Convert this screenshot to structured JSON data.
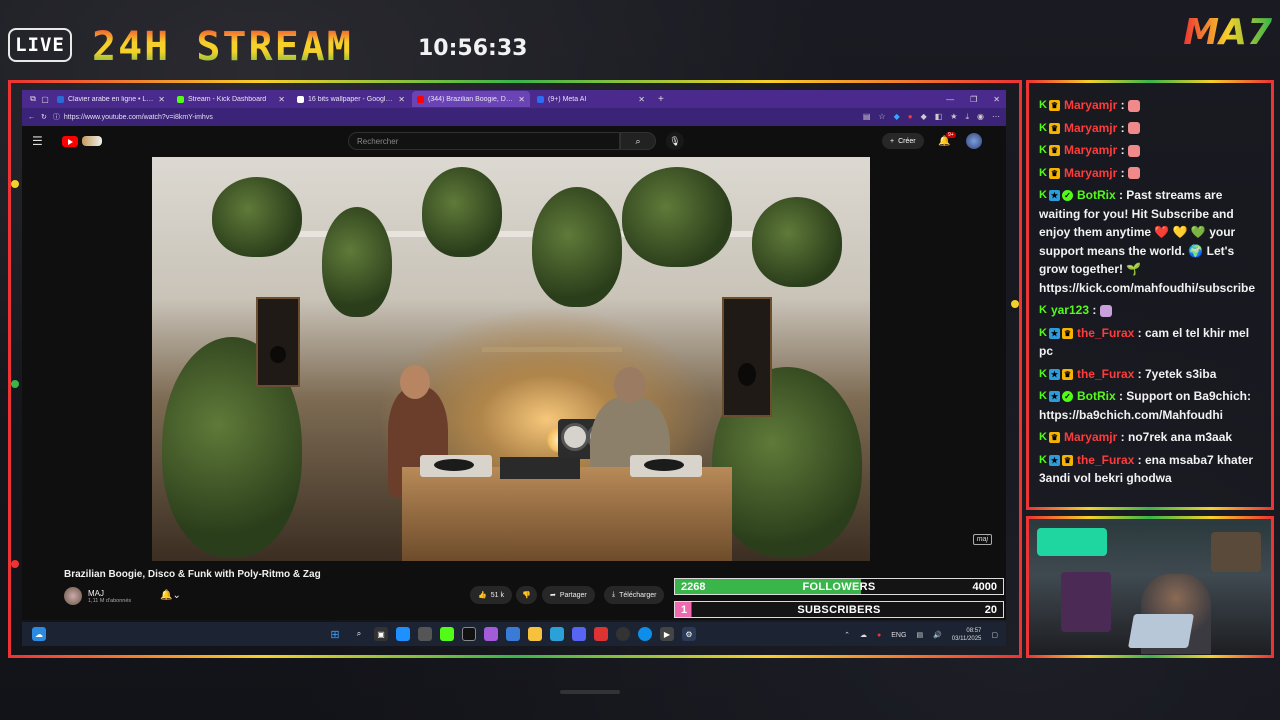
{
  "banner": {
    "live_label": "LIVE",
    "stream_title": "24H STREAM",
    "clock": "10:56:33",
    "logo_text": "MA7"
  },
  "browser": {
    "tabs": [
      {
        "label": "Clavier arabe en ligne • Lexilogos",
        "fav_color": "#2a6bd6",
        "active": false
      },
      {
        "label": "Stream - Kick Dashboard",
        "fav_color": "#53fc18",
        "active": false
      },
      {
        "label": "16 bits wallpaper - Google Search",
        "fav_color": "#ffffff",
        "active": false
      },
      {
        "label": "(344) Brazilian Boogie, Disco",
        "fav_color": "#ff0000",
        "active": true
      },
      {
        "label": "(9+) Meta AI",
        "fav_color": "#2d6cf5",
        "active": false
      }
    ],
    "url": "https://www.youtube.com/watch?v=i8kmY-imhvs"
  },
  "youtube": {
    "search_placeholder": "Rechercher",
    "create_label": "Créer",
    "notif_count": "9+",
    "watermark": "maj",
    "video_title": "Brazilian Boogie, Disco & Funk with Poly-Ritmo & Zag",
    "channel_name": "MAJ",
    "channel_subs": "1,11 M d'abonnés",
    "like_count": "51 k",
    "share_label": "Partager",
    "download_label": "Télécharger"
  },
  "goals": {
    "followers": {
      "current": "2268",
      "label": "FOLLOWERS",
      "target": "4000",
      "progress": 0.567
    },
    "subscribers": {
      "current": "1",
      "label": "SUBSCRIBERS",
      "target": "20",
      "progress": 0.05
    }
  },
  "taskbar": {
    "lang": "ENG",
    "time": "08:57",
    "date": "03/11/2025"
  },
  "chat": [
    {
      "user": "Maryamjr",
      "color": "#ff3b3b",
      "badges": [
        "k",
        "mod"
      ],
      "text": "",
      "emote": "#f08a8a"
    },
    {
      "user": "Maryamjr",
      "color": "#ff3b3b",
      "badges": [
        "k",
        "mod"
      ],
      "text": "",
      "emote": "#f08a8a"
    },
    {
      "user": "Maryamjr",
      "color": "#ff3b3b",
      "badges": [
        "k",
        "mod"
      ],
      "text": "",
      "emote": "#f08a8a"
    },
    {
      "user": "Maryamjr",
      "color": "#ff3b3b",
      "badges": [
        "k",
        "mod"
      ],
      "text": "",
      "emote": "#f08a8a"
    },
    {
      "user": "BotRix",
      "color": "#53fc18",
      "badges": [
        "k",
        "sub",
        "verif"
      ],
      "text": "Past streams are waiting for you! Hit Subscribe and enjoy them anytime ❤️ 💛 💚 your support means the world. 🌍 Let's grow together! 🌱 https://kick.com/mahfoudhi/subscribe",
      "emote": ""
    },
    {
      "user": "yar123",
      "color": "#53fc18",
      "badges": [
        "k"
      ],
      "text": "",
      "emote": "#c9a0dc"
    },
    {
      "user": "the_Furax",
      "color": "#ff3b3b",
      "badges": [
        "k",
        "sub",
        "mod"
      ],
      "text": "cam el tel khir mel pc",
      "emote": ""
    },
    {
      "user": "the_Furax",
      "color": "#ff3b3b",
      "badges": [
        "k",
        "sub",
        "mod"
      ],
      "text": "7yetek s3iba",
      "emote": ""
    },
    {
      "user": "BotRix",
      "color": "#53fc18",
      "badges": [
        "k",
        "sub",
        "verif"
      ],
      "text": "Support on Ba9chich: https://ba9chich.com/Mahfoudhi",
      "emote": ""
    },
    {
      "user": "Maryamjr",
      "color": "#ff3b3b",
      "badges": [
        "k",
        "mod"
      ],
      "text": "no7rek ana m3aak",
      "emote": ""
    },
    {
      "user": "the_Furax",
      "color": "#ff3b3b",
      "badges": [
        "k",
        "sub",
        "mod"
      ],
      "text": "ena msaba7 khater 3andi vol bekri ghodwa",
      "emote": ""
    }
  ]
}
